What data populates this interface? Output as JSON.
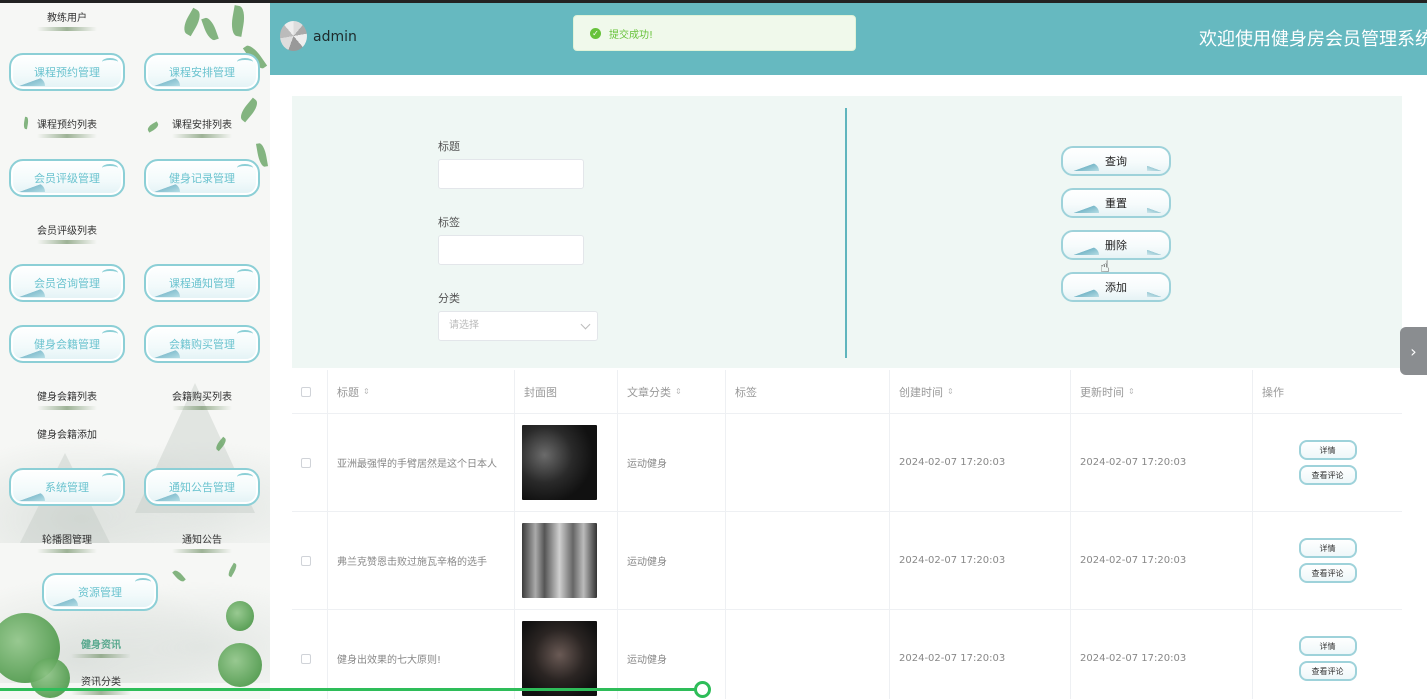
{
  "header": {
    "username": "admin",
    "site_title": "欢迎使用健身房会员管理系统",
    "toast": "提交成功!"
  },
  "sidebar": {
    "top_item": "教练用户",
    "groups": [
      {
        "label": "课程预约管理",
        "children": [
          "课程预约列表"
        ]
      },
      {
        "label": "课程安排管理",
        "children": [
          "课程安排列表"
        ]
      },
      {
        "label": "会员评级管理",
        "children": [
          "会员评级列表"
        ]
      },
      {
        "label": "健身记录管理",
        "children": []
      },
      {
        "label": "会员咨询管理",
        "children": []
      },
      {
        "label": "课程通知管理",
        "children": []
      },
      {
        "label": "健身会籍管理",
        "children": [
          "健身会籍列表",
          "健身会籍添加"
        ]
      },
      {
        "label": "会籍购买管理",
        "children": [
          "会籍购买列表"
        ]
      },
      {
        "label": "系统管理",
        "children": [
          "轮播图管理"
        ]
      },
      {
        "label": "通知公告管理",
        "children": [
          "通知公告"
        ]
      },
      {
        "label": "资源管理",
        "children": [
          "健身资讯",
          "资讯分类"
        ]
      }
    ]
  },
  "search": {
    "title_label": "标题",
    "tag_label": "标签",
    "category_label": "分类",
    "category_placeholder": "请选择",
    "buttons": {
      "query": "查询",
      "reset": "重置",
      "delete": "删除",
      "add": "添加"
    }
  },
  "table": {
    "columns": [
      "标题",
      "封面图",
      "文章分类",
      "标签",
      "创建时间",
      "更新时间",
      "操作"
    ],
    "rows": [
      {
        "title": "亚洲最强悍的手臂居然是这个日本人",
        "category": "运动健身",
        "tag": "",
        "created": "2024-02-07 17:20:03",
        "updated": "2024-02-07 17:20:03"
      },
      {
        "title": "弗兰克赞恩击败过施瓦辛格的选手",
        "category": "运动健身",
        "tag": "",
        "created": "2024-02-07 17:20:03",
        "updated": "2024-02-07 17:20:03"
      },
      {
        "title": "健身出效果的七大原则!",
        "category": "运动健身",
        "tag": "",
        "created": "2024-02-07 17:20:03",
        "updated": "2024-02-07 17:20:03"
      }
    ],
    "op_labels": {
      "detail": "详情",
      "comments": "查看评论"
    }
  },
  "icons": {
    "right_tab": "chevron-right-icon",
    "toast": "success-check-icon",
    "sort": "sort-caret-icon"
  },
  "colors": {
    "header": "#66b9c0",
    "accent": "#5fb5bd",
    "success": "#67c23a",
    "progress": "#2ebd59"
  }
}
